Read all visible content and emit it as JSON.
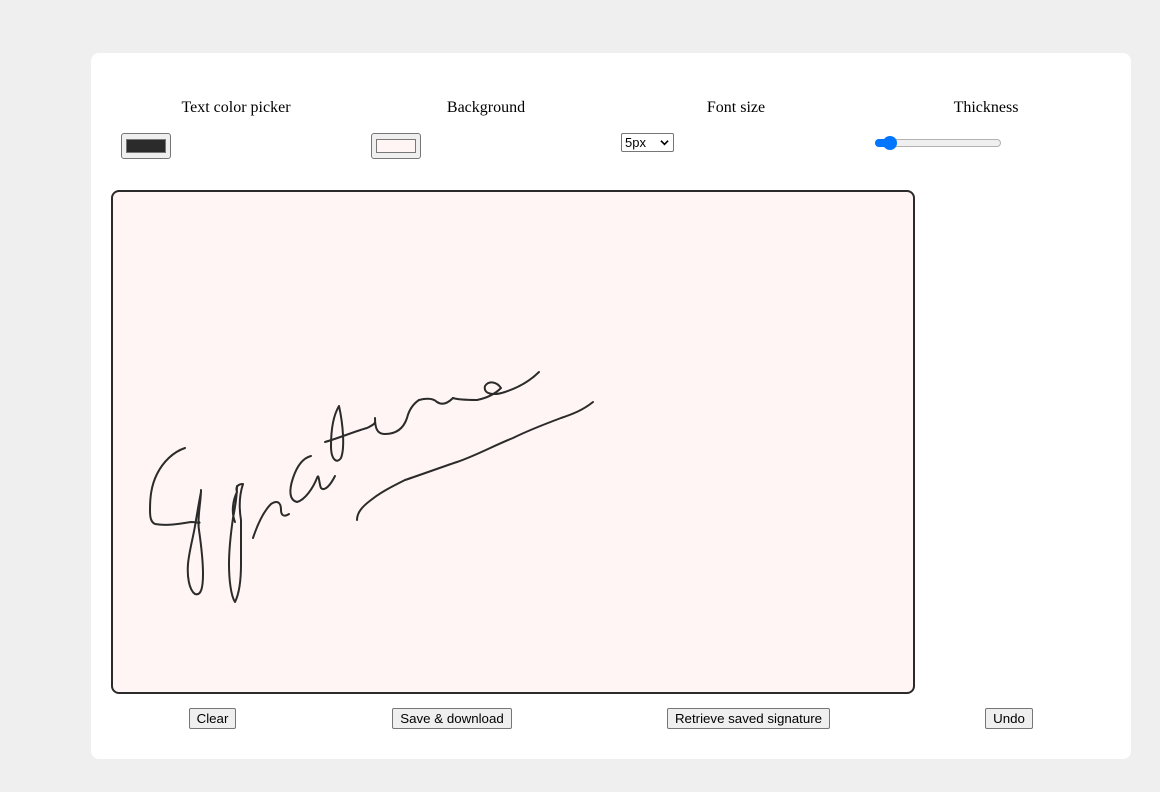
{
  "controls": {
    "text_color_label": "Text color picker",
    "background_label": "Background",
    "font_size_label": "Font size",
    "thickness_label": "Thickness",
    "text_color_value": "#2b2b2b",
    "background_value": "#fff5f4",
    "font_size_value": "5px",
    "thickness_level": 0.07
  },
  "canvas": {
    "border_color": "#2b2b2b",
    "background_color": "#fff5f4",
    "stroke_color": "#2b2b2b"
  },
  "buttons": {
    "clear": "Clear",
    "save_download": "Save & download",
    "retrieve": "Retrieve saved signature",
    "undo": "Undo"
  },
  "colors": {
    "accent": "#0075ff",
    "page_bg": "#efefef"
  }
}
